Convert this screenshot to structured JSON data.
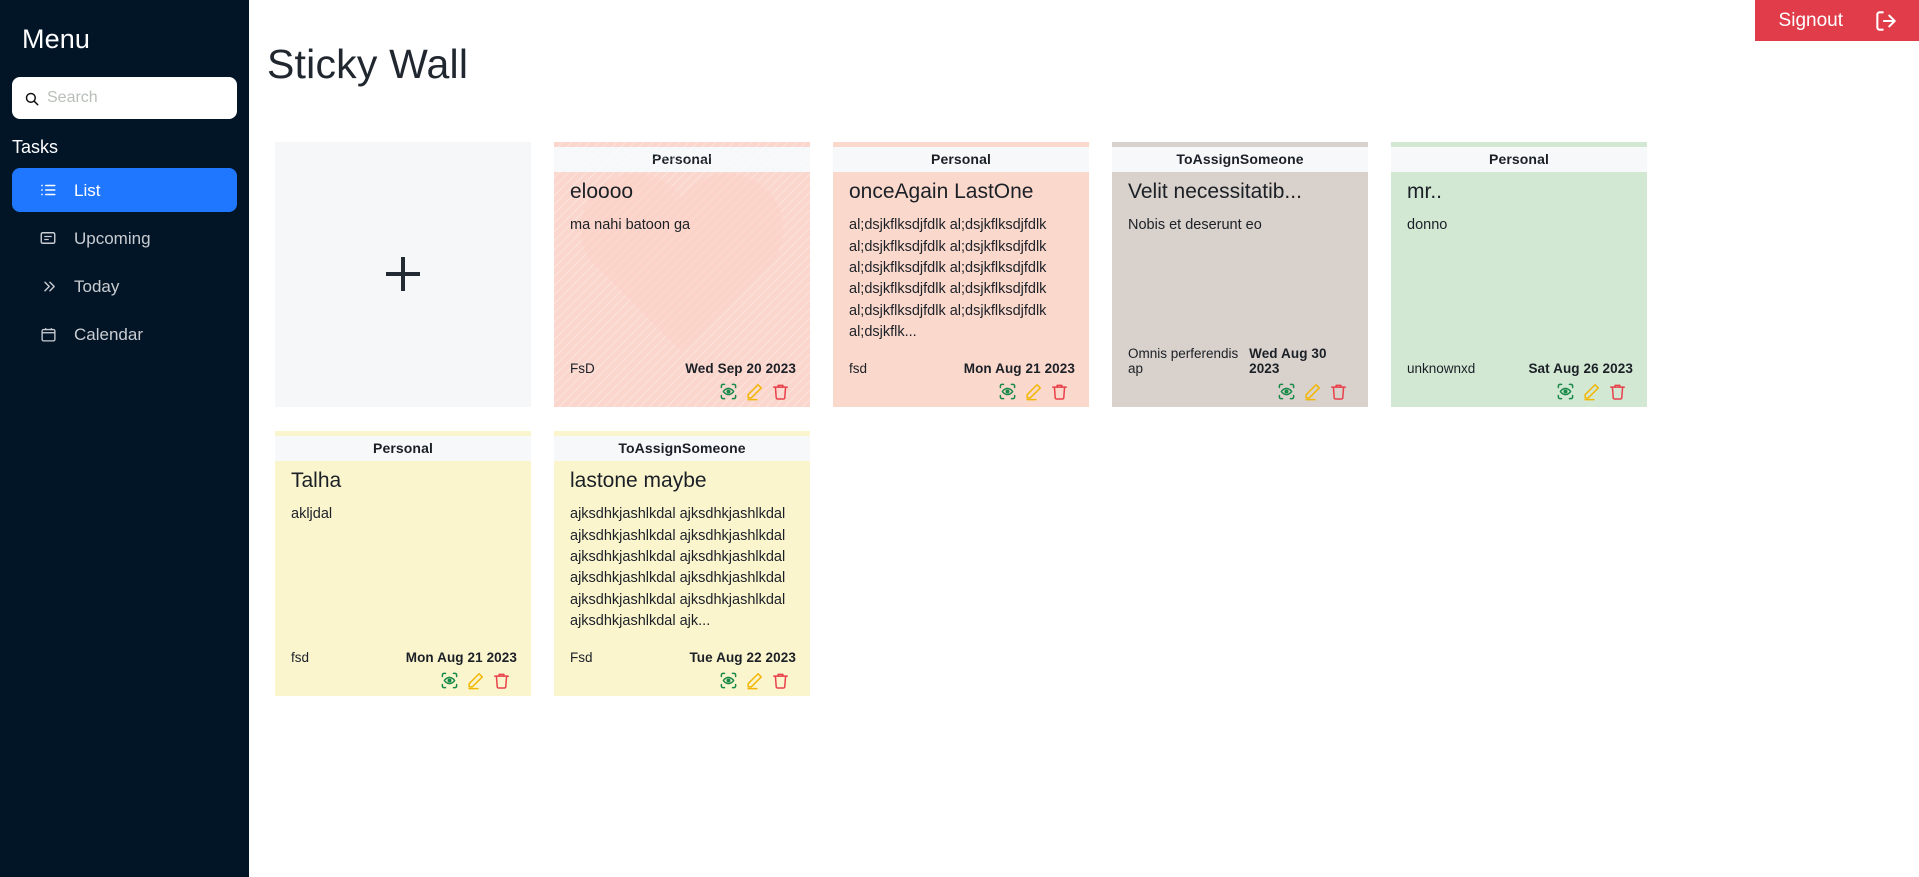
{
  "sidebar": {
    "menu_title": "Menu",
    "search": {
      "placeholder": "Search",
      "value": "",
      "icon": "search-icon"
    },
    "section_label": "Tasks",
    "items": [
      {
        "label": "List",
        "icon": "list-icon",
        "active": true
      },
      {
        "label": "Upcoming",
        "icon": "upcoming-icon",
        "active": false
      },
      {
        "label": "Today",
        "icon": "chevrons-right-icon",
        "active": false
      },
      {
        "label": "Calendar",
        "icon": "calendar-icon",
        "active": false
      }
    ]
  },
  "header": {
    "page_title": "Sticky Wall",
    "signout_label": "Signout",
    "signout_icon": "logout-icon",
    "signout_color": "#e03c4a"
  },
  "board": {
    "add_card": {
      "label": "+",
      "icon": "plus-icon"
    },
    "actions": {
      "view_label": "View",
      "edit_label": "Edit",
      "delete_label": "Delete",
      "view_color": "#1a8a4a",
      "edit_color": "#f2b705",
      "delete_color": "#e8404a"
    },
    "notes": [
      {
        "category": "Personal",
        "title": "eloooo",
        "text": "ma nahi batoon ga",
        "owner": "FsD",
        "date": "Wed Sep 20 2023",
        "color": "#fad6cd",
        "accent": "#fad6cd",
        "watermark": true
      },
      {
        "category": "Personal",
        "title": "onceAgain LastOne",
        "text": "al;dsjkflksdjfdlk al;dsjkflksdjfdlk al;dsjkflksdjfdlk al;dsjkflksdjfdlk al;dsjkflksdjfdlk al;dsjkflksdjfdlk al;dsjkflksdjfdlk al;dsjkflksdjfdlk al;dsjkflksdjfdlk al;dsjkflksdjfdlk al;dsjkflk...",
        "owner": "fsd",
        "date": "Mon Aug 21 2023",
        "color": "#fbd8cc",
        "accent": "#fbd8cc",
        "watermark": false
      },
      {
        "category": "ToAssignSomeone",
        "title": "Velit necessitatib...",
        "text": "Nobis et deserunt eo",
        "owner": "Omnis perferendis ap",
        "date": "Wed Aug 30 2023",
        "color": "#d9d1cb",
        "accent": "#d9d1cb",
        "watermark": false
      },
      {
        "category": "Personal",
        "title": "mr..",
        "text": "donno",
        "owner": "unknownxd",
        "date": "Sat Aug 26 2023",
        "color": "#d2e8d3",
        "accent": "#d2e8d3",
        "watermark": false
      },
      {
        "category": "Personal",
        "title": "Talha",
        "text": "akljdal",
        "owner": "fsd",
        "date": "Mon Aug 21 2023",
        "color": "#fbf5ce",
        "accent": "#fbf5ce",
        "watermark": false
      },
      {
        "category": "ToAssignSomeone",
        "title": "lastone maybe",
        "text": "ajksdhkjashlkdal ajksdhkjashlkdal ajksdhkjashlkdal ajksdhkjashlkdal ajksdhkjashlkdal ajksdhkjashlkdal ajksdhkjashlkdal ajksdhkjashlkdal ajksdhkjashlkdal ajksdhkjashlkdal ajksdhkjashlkdal ajk...",
        "owner": "Fsd",
        "date": "Tue Aug 22 2023",
        "color": "#fbf5ce",
        "accent": "#fbf5ce",
        "watermark": false
      }
    ]
  }
}
